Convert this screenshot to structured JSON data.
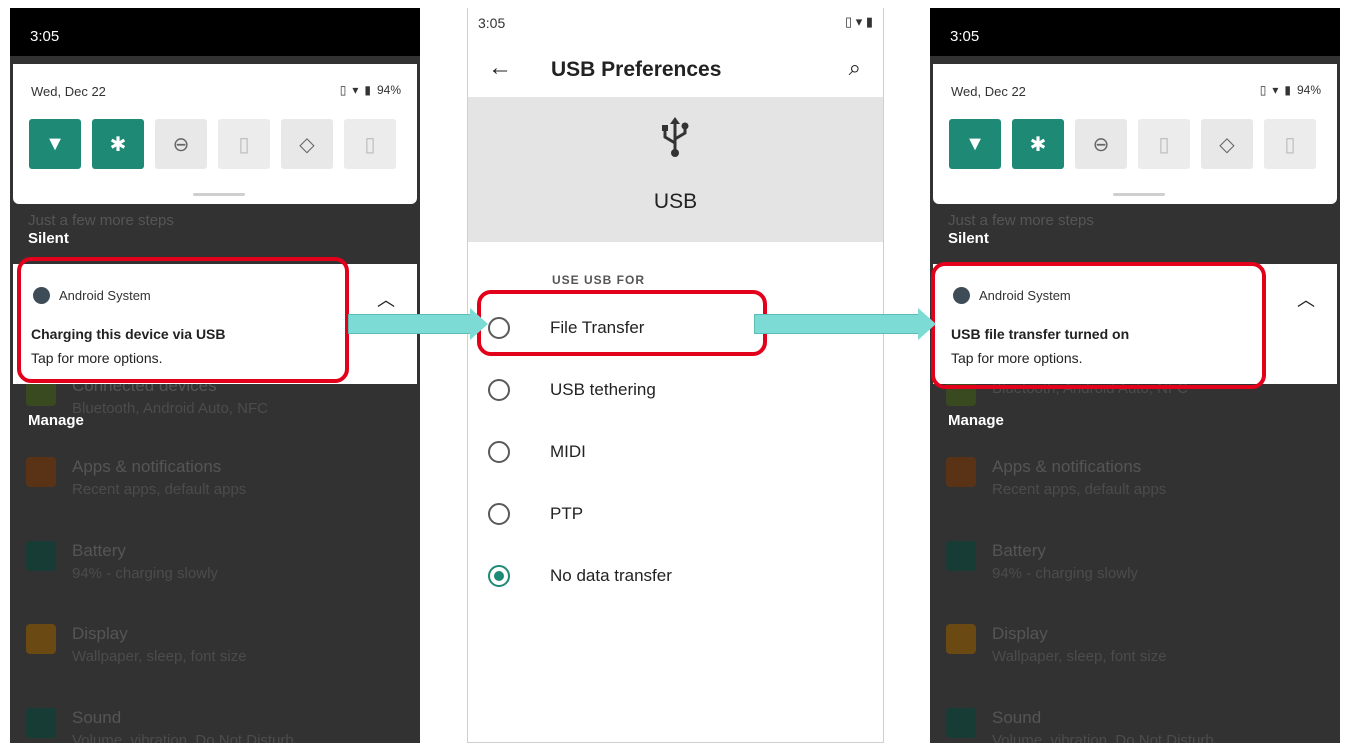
{
  "left_phone": {
    "time": "3:05",
    "date": "Wed, Dec 22",
    "battery": "94%",
    "under_text": "Just a few more steps",
    "silent_label": "Silent",
    "manage_label": "Manage",
    "notification": {
      "app": "Android System",
      "title": "Charging this device via USB",
      "body": "Tap for more options."
    },
    "dim_items": [
      {
        "title": "Connected devices",
        "sub": "Bluetooth, Android Auto, NFC",
        "color": "#3a4a20"
      },
      {
        "title": "Apps & notifications",
        "sub": "Recent apps, default apps",
        "color": "#5a3316"
      },
      {
        "title": "Battery",
        "sub": "94% - charging slowly",
        "color": "#173c36"
      },
      {
        "title": "Display",
        "sub": "Wallpaper, sleep, font size",
        "color": "#6a4a12"
      },
      {
        "title": "Sound",
        "sub": "Volume, vibration, Do Not Disturb",
        "color": "#173c36"
      }
    ]
  },
  "middle_phone": {
    "time": "3:05",
    "title": "USB Preferences",
    "header_label": "USB",
    "section": "USE USB FOR",
    "options": [
      {
        "label": "File Transfer",
        "checked": false
      },
      {
        "label": "USB tethering",
        "checked": false
      },
      {
        "label": "MIDI",
        "checked": false
      },
      {
        "label": "PTP",
        "checked": false
      },
      {
        "label": "No data transfer",
        "checked": true
      }
    ]
  },
  "right_phone": {
    "time": "3:05",
    "date": "Wed, Dec 22",
    "battery": "94%",
    "under_text": "Just a few more steps",
    "silent_label": "Silent",
    "manage_label": "Manage",
    "notification": {
      "app": "Android System",
      "title": "USB file transfer turned on",
      "body": "Tap for more options."
    },
    "dim_items": [
      {
        "title": "",
        "sub": "Bluetooth, Android Auto, NFC",
        "color": "#3a4a20"
      },
      {
        "title": "Apps & notifications",
        "sub": "Recent apps, default apps",
        "color": "#5a3316"
      },
      {
        "title": "Battery",
        "sub": "94% - charging slowly",
        "color": "#173c36"
      },
      {
        "title": "Display",
        "sub": "Wallpaper, sleep, font size",
        "color": "#6a4a12"
      },
      {
        "title": "Sound",
        "sub": "Volume, vibration, Do Not Disturb",
        "color": "#173c36"
      }
    ]
  },
  "colors": {
    "accent": "#1e8a76",
    "highlight": "#e2001a",
    "arrow": "#7ddbd6"
  }
}
